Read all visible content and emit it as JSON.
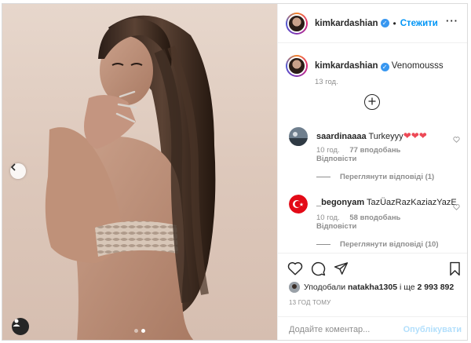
{
  "post": {
    "username": "kimkardashian",
    "follow_label": "Стежити",
    "separator": "•",
    "more_label": "···"
  },
  "caption": {
    "username": "kimkardashian",
    "text": "Venomousss",
    "time": "13 год."
  },
  "comments": [
    {
      "username": "saardinaaaa",
      "text": "Turkeyyy",
      "emoji": "❤❤❤",
      "time": "10 год.",
      "likes": "77 вподобань",
      "reply_label": "Відповісти",
      "view_replies": "Переглянути відповіді (1)"
    },
    {
      "username": "_begonyam",
      "text": "TazÜazRazKaziazYazE",
      "time": "10 год.",
      "likes": "58 вподобань",
      "reply_label": "Відповісти",
      "view_replies": "Переглянути відповіді (10)"
    }
  ],
  "likes": {
    "prefix": "Уподобали",
    "user": "natakha1305",
    "middle": "і ще",
    "count": "2 993 892"
  },
  "post_time": "13 ГОД ТОМУ",
  "comment_input": {
    "placeholder": "Додайте коментар...",
    "publish_label": "Опублікувати"
  },
  "carousel": {
    "current": 1,
    "total": 2
  },
  "colors": {
    "accent": "#0095f6",
    "publish_disabled": "#b2dffc",
    "heart_red": "#ed4956",
    "muted": "#8e8e8e"
  },
  "icons": {
    "like": "heart-icon",
    "comment": "comment-icon",
    "share": "send-icon",
    "save": "bookmark-icon",
    "add": "plus-circle-icon",
    "tag": "user-tag-icon",
    "prev": "chevron-left-icon",
    "verified": "verified-badge-icon"
  }
}
